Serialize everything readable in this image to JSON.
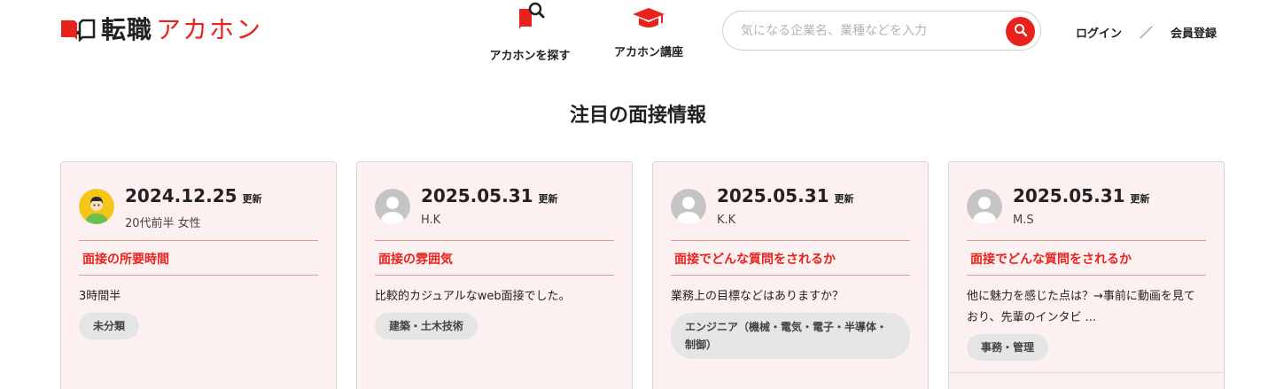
{
  "logo": {
    "text_main": "転職",
    "text_brand": "アカホン"
  },
  "nav": {
    "find_label": "アカホンを探す",
    "course_label": "アカホン講座"
  },
  "search": {
    "placeholder": "気になる企業名、業種などを入力"
  },
  "auth": {
    "login": "ログイン",
    "separator": "／",
    "register": "会員登録"
  },
  "section": {
    "title": "注目の面接情報"
  },
  "cards": [
    {
      "date": "2024.12.25",
      "updated": "更新",
      "user": "20代前半 女性",
      "topic": "面接の所要時間",
      "body": "3時間半",
      "tag": "未分類",
      "avatar": "yellow-person-icon"
    },
    {
      "date": "2025.05.31",
      "updated": "更新",
      "user": "H.K",
      "topic": "面接の雰囲気",
      "body": "比較的カジュアルなweb面接でした。",
      "tag": "建築・土木技術",
      "avatar": "gray-person-icon"
    },
    {
      "date": "2025.05.31",
      "updated": "更新",
      "user": "K.K",
      "topic": "面接でどんな質問をされるか",
      "body": "業務上の目標などはありますか？",
      "tag": "エンジニア（機械・電気・電子・半導体・制御）",
      "avatar": "gray-person-icon"
    },
    {
      "date": "2025.05.31",
      "updated": "更新",
      "user": "M.S",
      "topic": "面接でどんな質問をされるか",
      "body": "他に魅力を感じた点は？→事前に動画を見ており、先輩のインタビ ...",
      "tag": "事務・管理",
      "avatar": "gray-person-icon"
    }
  ],
  "colors": {
    "accent": "#e8231d",
    "card_bg": "#fdf0f1",
    "tag_bg": "#e5e5e5"
  }
}
